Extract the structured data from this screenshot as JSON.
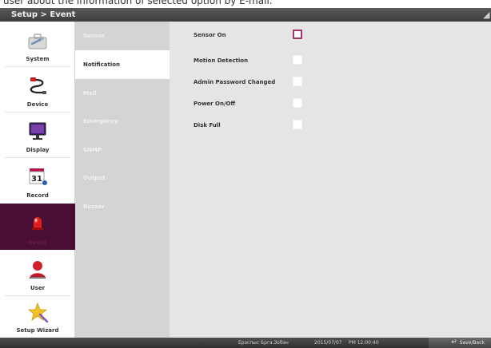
{
  "caption": "user about the information of selected option by E-mail.",
  "window": {
    "title": "Setup > Event"
  },
  "sidebar": {
    "items": [
      {
        "label": "System",
        "icon": "toolbox-icon",
        "active": false
      },
      {
        "label": "Device",
        "icon": "cable-plug-icon",
        "active": false
      },
      {
        "label": "Display",
        "icon": "monitor-icon",
        "active": false
      },
      {
        "label": "Record",
        "icon": "calendar-icon",
        "active": false
      },
      {
        "label": "Event",
        "icon": "alarm-siren-icon",
        "active": true
      },
      {
        "label": "User",
        "icon": "user-icon",
        "active": false
      },
      {
        "label": "Setup Wizard",
        "icon": "wizard-star-icon",
        "active": false
      }
    ]
  },
  "submenu": {
    "items": [
      {
        "label": "Sensor",
        "active": false
      },
      {
        "label": "Notification",
        "active": true
      },
      {
        "label": "Mail",
        "active": false
      },
      {
        "label": "Emergency",
        "active": false
      },
      {
        "label": "SNMP",
        "active": false
      },
      {
        "label": "Output",
        "active": false
      },
      {
        "label": "Buzzer",
        "active": false
      }
    ]
  },
  "options": [
    {
      "label": "Sensor On",
      "checked": false,
      "focused": true
    },
    {
      "label": "Motion Detection",
      "checked": false,
      "focused": false
    },
    {
      "label": "Admin Password Changed",
      "checked": false,
      "focused": false
    },
    {
      "label": "Power On/Off",
      "checked": false,
      "focused": false
    },
    {
      "label": "Disk Full",
      "checked": false,
      "focused": false
    }
  ],
  "status": {
    "text1": "Ерэспыс Бргэ.Зобэн",
    "date": "2015/07/07",
    "time": "PM 12:00:40",
    "save_back_label": "Save/Back"
  },
  "colors": {
    "accent": "#4a0d33",
    "focus": "#a5336e",
    "titlebar": "#4a4a4a"
  }
}
